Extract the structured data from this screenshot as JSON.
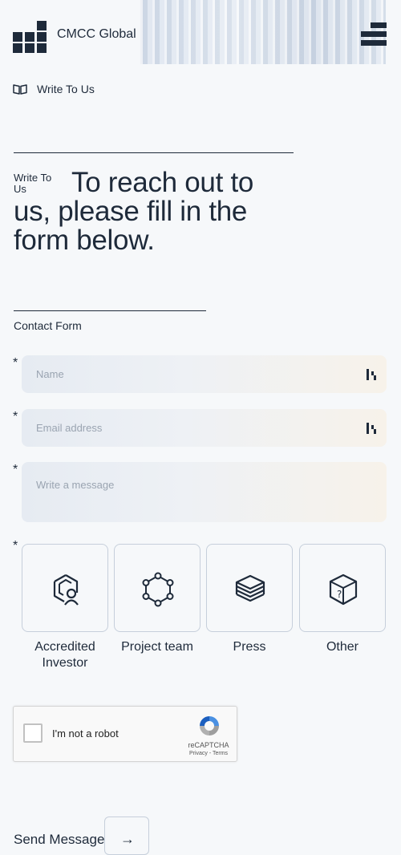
{
  "header": {
    "brand": "CMCC Global",
    "logo_icon": "grid-blocks-logo",
    "menu_icon": "hamburger-menu-icon"
  },
  "breadcrumb": {
    "icon": "open-book-icon",
    "label": "Write To Us"
  },
  "intro": {
    "eyebrow": "Write To Us",
    "headline": "To reach out to us, please fill in the form below."
  },
  "form": {
    "section_label": "Contact Form",
    "required_mark": "*",
    "name_placeholder": "Name",
    "email_placeholder": "Email address",
    "message_placeholder": "Write a message",
    "options": [
      {
        "label": "Accredited Investor",
        "icon": "investor-badge-icon"
      },
      {
        "label": "Project team",
        "icon": "network-hexagon-icon"
      },
      {
        "label": "Press",
        "icon": "layers-stack-icon"
      },
      {
        "label": "Other",
        "icon": "question-cube-icon"
      }
    ],
    "captcha": {
      "label": "I'm not a robot",
      "brand": "reCAPTCHA",
      "links": "Privacy - Terms"
    },
    "submit_label": "Send Message",
    "submit_icon": "arrow-right-icon"
  },
  "colors": {
    "text": "#1e2a3a",
    "background": "#f6f8fa",
    "field_gradient_start": "#e6ebf2",
    "field_gradient_end": "#f7f2ea"
  }
}
